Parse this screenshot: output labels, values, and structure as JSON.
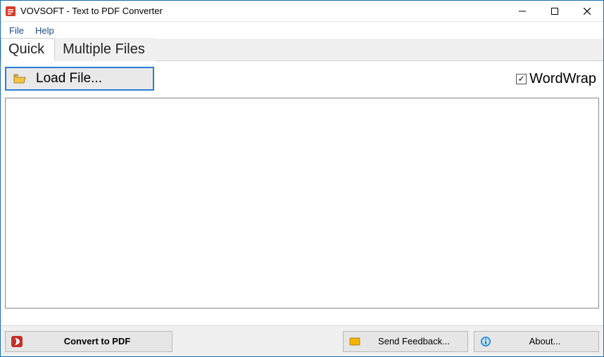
{
  "window": {
    "title": "VOVSOFT - Text to PDF Converter"
  },
  "menu": {
    "file": "File",
    "help": "Help"
  },
  "tabs": {
    "quick": "Quick",
    "multiple": "Multiple Files"
  },
  "toolbar": {
    "load_label": "Load File..."
  },
  "wordwrap": {
    "label": "WordWrap",
    "checked": true
  },
  "editor": {
    "value": ""
  },
  "footer": {
    "convert_label": "Convert to PDF",
    "feedback_label": "Send Feedback...",
    "about_label": "About..."
  }
}
